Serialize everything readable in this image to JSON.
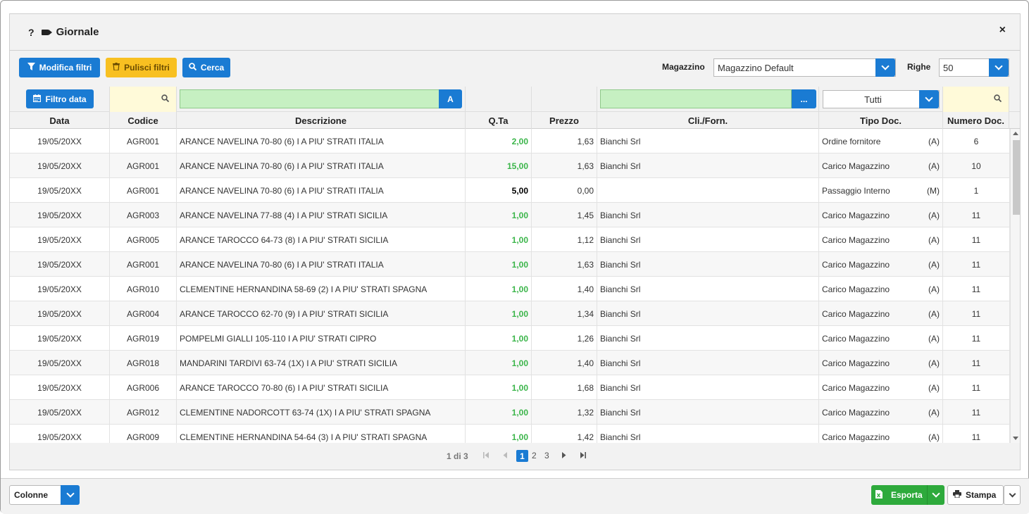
{
  "window": {
    "help_label": "?",
    "title": "Giornale",
    "close_label": "×"
  },
  "toolbar": {
    "modifica_filtri": "Modifica filtri",
    "pulisci_filtri": "Pulisci filtri",
    "cerca": "Cerca",
    "magazzino_label": "Magazzino",
    "magazzino_value": "Magazzino Default",
    "righe_label": "Righe",
    "righe_value": "50"
  },
  "filters": {
    "filtro_data": "Filtro data",
    "descrizione_btn": "A",
    "cliforn_btn": "...",
    "tipo_doc_value": "Tutti"
  },
  "columns": [
    "Data",
    "Codice",
    "Descrizione",
    "Q.Ta",
    "Prezzo",
    "Cli./Forn.",
    "Tipo Doc.",
    "Numero Doc."
  ],
  "rows": [
    {
      "data": "19/05/20XX",
      "codice": "AGR001",
      "descrizione": "ARANCE NAVELINA 70-80 (6) I A PIU' STRATI ITALIA",
      "qta": "2,00",
      "qta_color": "green",
      "prezzo": "1,63",
      "cliforn": "Bianchi Srl",
      "tipo": "Ordine fornitore",
      "tipo_flag": "(A)",
      "numero": "6"
    },
    {
      "data": "19/05/20XX",
      "codice": "AGR001",
      "descrizione": "ARANCE NAVELINA 70-80 (6) I A PIU' STRATI ITALIA",
      "qta": "15,00",
      "qta_color": "green",
      "prezzo": "1,63",
      "cliforn": "Bianchi Srl",
      "tipo": "Carico Magazzino",
      "tipo_flag": "(A)",
      "numero": "10"
    },
    {
      "data": "19/05/20XX",
      "codice": "AGR001",
      "descrizione": "ARANCE NAVELINA 70-80 (6) I A PIU' STRATI ITALIA",
      "qta": "5,00",
      "qta_color": "black",
      "prezzo": "0,00",
      "cliforn": "",
      "tipo": "Passaggio Interno",
      "tipo_flag": "(M)",
      "numero": "1"
    },
    {
      "data": "19/05/20XX",
      "codice": "AGR003",
      "descrizione": "ARANCE NAVELINA 77-88 (4) I A PIU' STRATI SICILIA",
      "qta": "1,00",
      "qta_color": "green",
      "prezzo": "1,45",
      "cliforn": "Bianchi Srl",
      "tipo": "Carico Magazzino",
      "tipo_flag": "(A)",
      "numero": "11"
    },
    {
      "data": "19/05/20XX",
      "codice": "AGR005",
      "descrizione": "ARANCE TAROCCO 64-73 (8) I A PIU' STRATI SICILIA",
      "qta": "1,00",
      "qta_color": "green",
      "prezzo": "1,12",
      "cliforn": "Bianchi Srl",
      "tipo": "Carico Magazzino",
      "tipo_flag": "(A)",
      "numero": "11"
    },
    {
      "data": "19/05/20XX",
      "codice": "AGR001",
      "descrizione": "ARANCE NAVELINA 70-80 (6) I A PIU' STRATI ITALIA",
      "qta": "1,00",
      "qta_color": "green",
      "prezzo": "1,63",
      "cliforn": "Bianchi Srl",
      "tipo": "Carico Magazzino",
      "tipo_flag": "(A)",
      "numero": "11"
    },
    {
      "data": "19/05/20XX",
      "codice": "AGR010",
      "descrizione": "CLEMENTINE HERNANDINA 58-69 (2) I A PIU' STRATI SPAGNA",
      "qta": "1,00",
      "qta_color": "green",
      "prezzo": "1,40",
      "cliforn": "Bianchi Srl",
      "tipo": "Carico Magazzino",
      "tipo_flag": "(A)",
      "numero": "11"
    },
    {
      "data": "19/05/20XX",
      "codice": "AGR004",
      "descrizione": "ARANCE TAROCCO 62-70 (9) I A PIU' STRATI SICILIA",
      "qta": "1,00",
      "qta_color": "green",
      "prezzo": "1,34",
      "cliforn": "Bianchi Srl",
      "tipo": "Carico Magazzino",
      "tipo_flag": "(A)",
      "numero": "11"
    },
    {
      "data": "19/05/20XX",
      "codice": "AGR019",
      "descrizione": "POMPELMI GIALLI 105-110 I A PIU' STRATI CIPRO",
      "qta": "1,00",
      "qta_color": "green",
      "prezzo": "1,26",
      "cliforn": "Bianchi Srl",
      "tipo": "Carico Magazzino",
      "tipo_flag": "(A)",
      "numero": "11"
    },
    {
      "data": "19/05/20XX",
      "codice": "AGR018",
      "descrizione": "MANDARINI TARDIVI 63-74 (1X) I A PIU' STRATI SICILIA",
      "qta": "1,00",
      "qta_color": "green",
      "prezzo": "1,40",
      "cliforn": "Bianchi Srl",
      "tipo": "Carico Magazzino",
      "tipo_flag": "(A)",
      "numero": "11"
    },
    {
      "data": "19/05/20XX",
      "codice": "AGR006",
      "descrizione": "ARANCE TAROCCO 70-80 (6) I A PIU' STRATI SICILIA",
      "qta": "1,00",
      "qta_color": "green",
      "prezzo": "1,68",
      "cliforn": "Bianchi Srl",
      "tipo": "Carico Magazzino",
      "tipo_flag": "(A)",
      "numero": "11"
    },
    {
      "data": "19/05/20XX",
      "codice": "AGR012",
      "descrizione": "CLEMENTINE NADORCOTT 63-74 (1X) I A PIU' STRATI SPAGNA",
      "qta": "1,00",
      "qta_color": "green",
      "prezzo": "1,32",
      "cliforn": "Bianchi Srl",
      "tipo": "Carico Magazzino",
      "tipo_flag": "(A)",
      "numero": "11"
    },
    {
      "data": "19/05/20XX",
      "codice": "AGR009",
      "descrizione": "CLEMENTINE HERNANDINA 54-64 (3) I A PIU' STRATI SPAGNA",
      "qta": "1,00",
      "qta_color": "green",
      "prezzo": "1,42",
      "cliforn": "Bianchi Srl",
      "tipo": "Carico Magazzino",
      "tipo_flag": "(A)",
      "numero": "11"
    }
  ],
  "pager": {
    "info": "1 di 3",
    "pages": [
      "1",
      "2",
      "3"
    ],
    "active": "1"
  },
  "footer": {
    "colonne": "Colonne",
    "esporta": "Esporta",
    "stampa": "Stampa"
  },
  "colors": {
    "accent": "#1a7bd3",
    "warning": "#f8c021",
    "success": "#2eaa3c",
    "qty_green": "#3bb54a",
    "filter_green": "#c6f0c2",
    "filter_yellow": "#fffad9"
  }
}
